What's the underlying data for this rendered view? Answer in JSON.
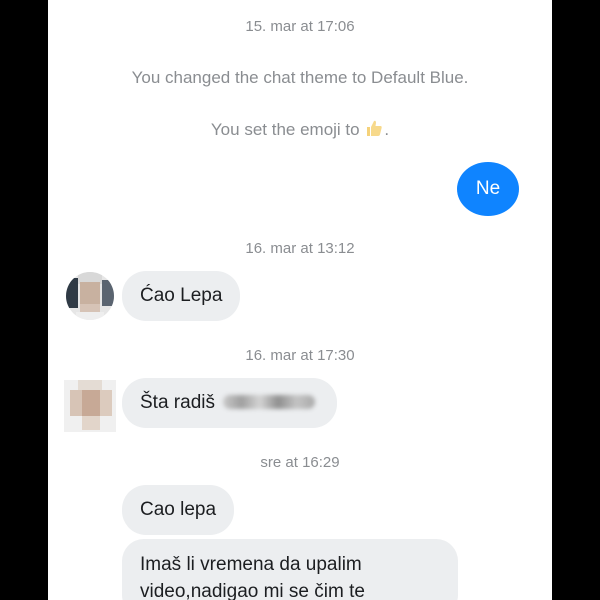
{
  "messages": {
    "ts1": "15. mar at 17:06",
    "theme_change": "You changed the chat theme to Default Blue.",
    "emoji_set": "You set the emoji to",
    "emoji_period": ".",
    "sent_ne": "Ne",
    "ts2": "16. mar at 13:12",
    "recv_cao_lepa_1": "Ćao Lepa",
    "ts3": "16. mar at 17:30",
    "recv_sta_radis": "Šta radiš",
    "ts4": "sre at 16:29",
    "recv_cao_lepa_2": "Cao lepa",
    "recv_long_line1": "Imaš li vremena da upalim",
    "recv_long_line2": "video,nadigao mi se čim te"
  },
  "colors": {
    "sent_bubble": "#0f84ff",
    "received_bubble": "#eceef0",
    "system_text": "#8a8d91"
  },
  "icons": {
    "emoji": "thumbs-up-icon"
  }
}
